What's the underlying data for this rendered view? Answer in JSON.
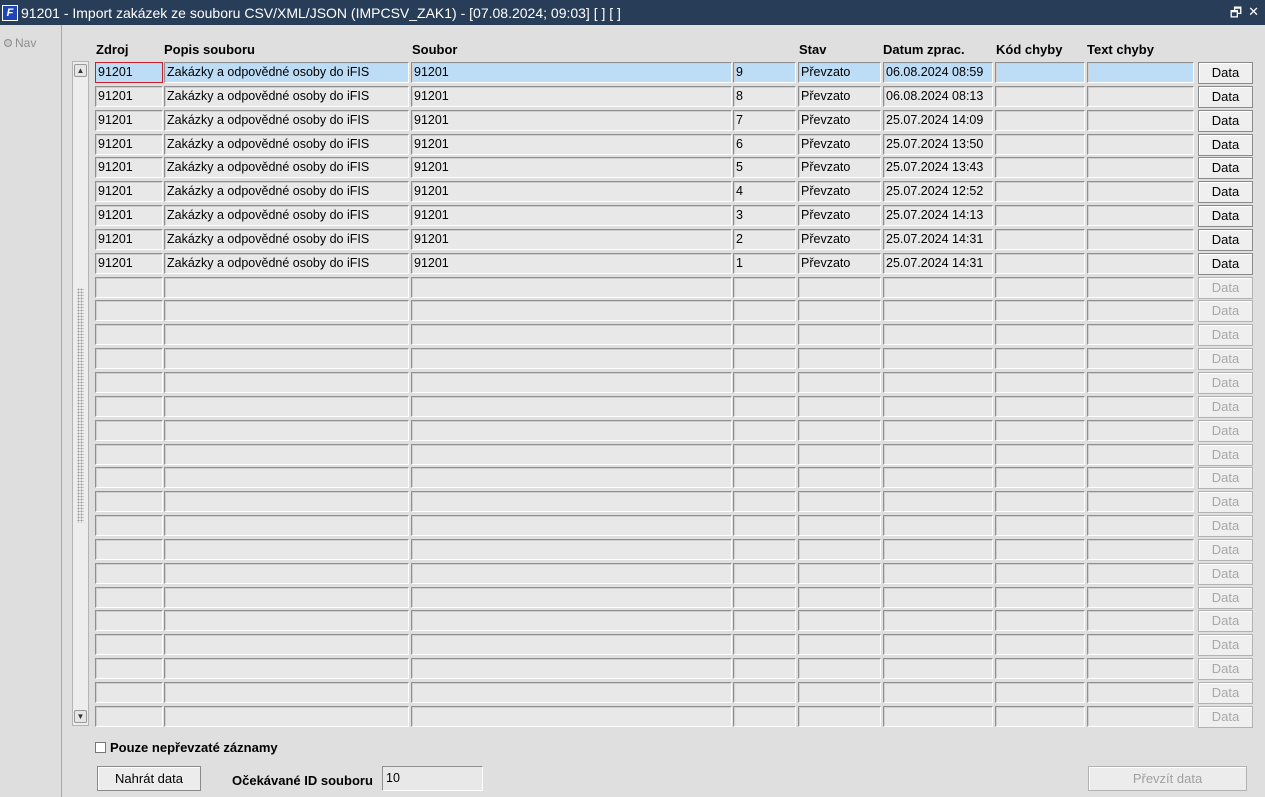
{
  "window": {
    "title": "91201 - Import zakázek ze souboru CSV/XML/JSON (IMPCSV_ZAK1) - [07.08.2024; 09:03]  [ ]  [ ]",
    "icon": "oracle-forms-icon",
    "restore_glyph": "🗗",
    "close_glyph": "✕"
  },
  "nav": {
    "label": "Nav"
  },
  "columns": {
    "zdroj": "Zdroj",
    "popis": "Popis souboru",
    "soubor": "Soubor",
    "stav": "Stav",
    "datum": "Datum zprac.",
    "kod": "Kód chyby",
    "text": "Text chyby"
  },
  "rows": [
    {
      "zdroj": "91201",
      "popis": "Zakázky a odpovědné osoby do iFIS",
      "soubor": "91201",
      "num": "9",
      "stav": "Převzato",
      "datum": "06.08.2024 08:59",
      "kod": "",
      "text": "",
      "btn": "Data"
    },
    {
      "zdroj": "91201",
      "popis": "Zakázky a odpovědné osoby do iFIS",
      "soubor": "91201",
      "num": "8",
      "stav": "Převzato",
      "datum": "06.08.2024 08:13",
      "kod": "",
      "text": "",
      "btn": "Data"
    },
    {
      "zdroj": "91201",
      "popis": "Zakázky a odpovědné osoby do iFIS",
      "soubor": "91201",
      "num": "7",
      "stav": "Převzato",
      "datum": "25.07.2024 14:09",
      "kod": "",
      "text": "",
      "btn": "Data"
    },
    {
      "zdroj": "91201",
      "popis": "Zakázky a odpovědné osoby do iFIS",
      "soubor": "91201",
      "num": "6",
      "stav": "Převzato",
      "datum": "25.07.2024 13:50",
      "kod": "",
      "text": "",
      "btn": "Data"
    },
    {
      "zdroj": "91201",
      "popis": "Zakázky a odpovědné osoby do iFIS",
      "soubor": "91201",
      "num": "5",
      "stav": "Převzato",
      "datum": "25.07.2024 13:43",
      "kod": "",
      "text": "",
      "btn": "Data"
    },
    {
      "zdroj": "91201",
      "popis": "Zakázky a odpovědné osoby do iFIS",
      "soubor": "91201",
      "num": "4",
      "stav": "Převzato",
      "datum": "25.07.2024 12:52",
      "kod": "",
      "text": "",
      "btn": "Data"
    },
    {
      "zdroj": "91201",
      "popis": "Zakázky a odpovědné osoby do iFIS",
      "soubor": "91201",
      "num": "3",
      "stav": "Převzato",
      "datum": "25.07.2024 14:13",
      "kod": "",
      "text": "",
      "btn": "Data"
    },
    {
      "zdroj": "91201",
      "popis": "Zakázky a odpovědné osoby do iFIS",
      "soubor": "91201",
      "num": "2",
      "stav": "Převzato",
      "datum": "25.07.2024 14:31",
      "kod": "",
      "text": "",
      "btn": "Data"
    },
    {
      "zdroj": "91201",
      "popis": "Zakázky a odpovědné osoby do iFIS",
      "soubor": "91201",
      "num": "1",
      "stav": "Převzato",
      "datum": "25.07.2024 14:31",
      "kod": "",
      "text": "",
      "btn": "Data"
    }
  ],
  "empty_rows": 19,
  "empty_btn_label": "Data",
  "filter": {
    "label": "Pouze nepřevzaté záznamy",
    "checked": false
  },
  "footer": {
    "load_button": "Nahrát data",
    "expected_id_label": "Očekávané ID souboru",
    "expected_id_value": "10",
    "take_button": "Převzít data"
  },
  "scrollbar": {
    "up_icon": "▲",
    "down_icon": "▼"
  }
}
